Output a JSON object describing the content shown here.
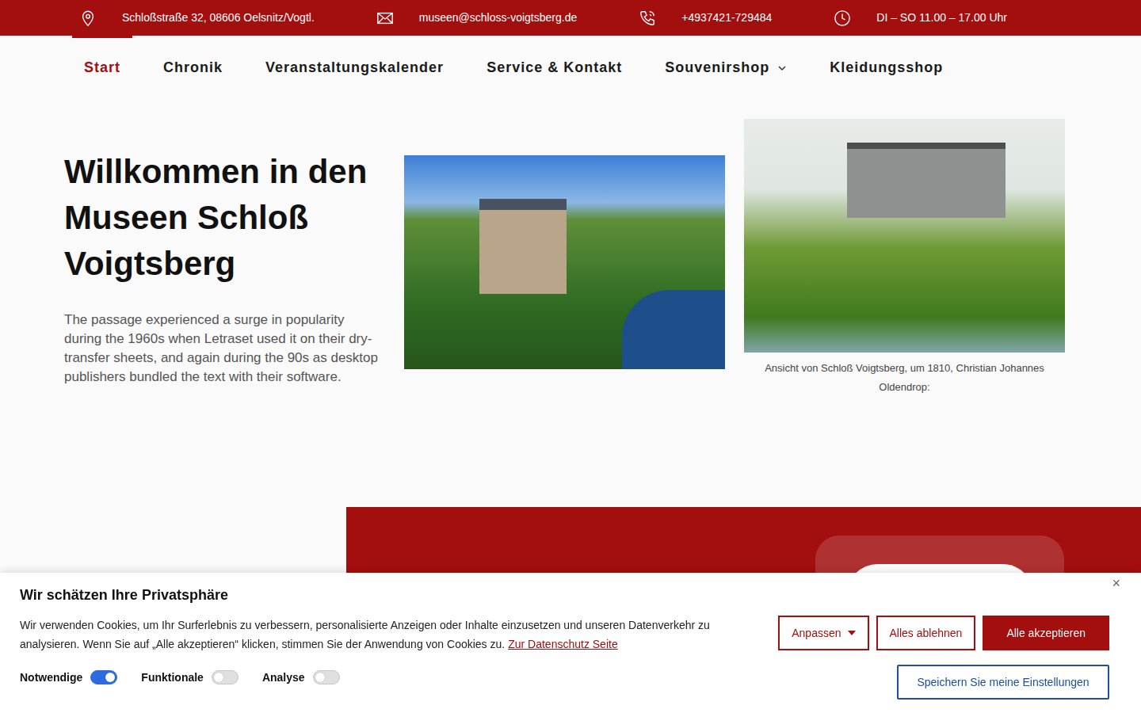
{
  "topbar": {
    "items": [
      {
        "kind": "pin",
        "text": "Schloßstraße 32, 08606 Oelsnitz/Vogtl."
      },
      {
        "kind": "mail",
        "text": "museen@schloss-voigtsberg.de"
      },
      {
        "kind": "phone",
        "text": "+4937421-729484"
      },
      {
        "kind": "clock",
        "text": "DI – SO 11.00 – 17.00 Uhr"
      }
    ]
  },
  "nav": {
    "items": [
      {
        "label": "Start",
        "selected": true,
        "has_dropdown": false
      },
      {
        "label": "Chronik",
        "selected": false,
        "has_dropdown": false
      },
      {
        "label": "Veranstaltungskalender",
        "selected": false,
        "has_dropdown": false
      },
      {
        "label": "Service & Kontakt",
        "selected": false,
        "has_dropdown": false
      },
      {
        "label": "Souvenirshop",
        "selected": false,
        "has_dropdown": true
      },
      {
        "label": "Kleidungsshop",
        "selected": false,
        "has_dropdown": false
      }
    ]
  },
  "hero": {
    "title": "Willkommen in den Museen Schloß Voigtsberg",
    "text": "The passage experienced a surge in popularity during the 1960s when Letraset used it on their dry-transfer sheets, and again during the 90s as desktop publishers bundled the text with their software.",
    "caption": "Ansicht von Schloß Voigtsberg, um 1810, Christian Johannes Oldendrop:"
  },
  "cookie": {
    "title": "Wir schätzen Ihre Privatsphäre",
    "text": "Wir verwenden Cookies, um Ihr Surferlebnis zu verbessern, personalisierte Anzeigen oder Inhalte einzusetzen und unseren Datenverkehr zu analysieren. Wenn Sie auf „Alle akzeptieren“ klicken, stimmen Sie der Anwendung von Cookies zu.",
    "link": "Zur Datenschutz Seite",
    "close": "×",
    "toggles": [
      {
        "label": "Notwendige",
        "on": true
      },
      {
        "label": "Funktionale",
        "on": false
      },
      {
        "label": "Analyse",
        "on": false
      }
    ],
    "buttons": [
      {
        "label": "Anpassen",
        "kind": "dropdown"
      },
      {
        "label": "Alles ablehnen",
        "kind": "outline"
      },
      {
        "label": "Alle akzeptieren",
        "kind": "solid"
      }
    ],
    "save": "Speichern Sie meine Einstellungen"
  }
}
